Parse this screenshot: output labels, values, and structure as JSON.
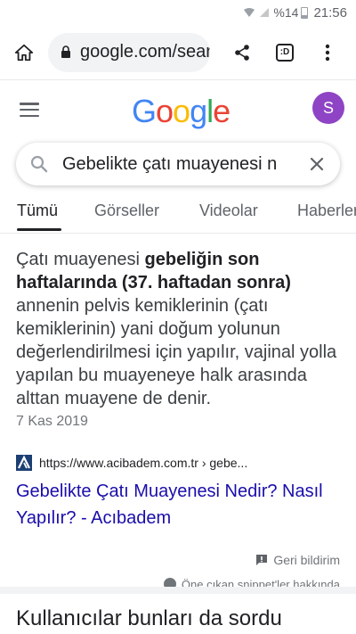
{
  "status_bar": {
    "battery_percent": "%14",
    "time": "21:56"
  },
  "chrome": {
    "url": "google.com/search"
  },
  "header": {
    "logo_letters": [
      "G",
      "o",
      "o",
      "g",
      "l",
      "e"
    ],
    "logo_colors": [
      "#4285F4",
      "#EA4335",
      "#FBBC05",
      "#4285F4",
      "#34A853",
      "#EA4335"
    ],
    "avatar_letter": "S",
    "avatar_color": "#8e44c4"
  },
  "search": {
    "query": "Gebelikte çatı muayenesi n"
  },
  "tabs": [
    {
      "label": "Tümü",
      "active": true
    },
    {
      "label": "Görseller"
    },
    {
      "label": "Videolar"
    },
    {
      "label": "Haberler"
    }
  ],
  "snippet": {
    "text_pre": "Çatı muayenesi ",
    "text_bold": "gebeliğin son haftalarında (37. haftadan sonra)",
    "text_post": " annenin pelvis kemiklerinin (çatı kemiklerinin) yani doğum yolunun değerlendirilmesi için yapılır, vajinal yolla yapılan bu muayeneye halk arasında alttan muayene de denir.",
    "date": "7 Kas 2019"
  },
  "result": {
    "url": "https://www.acibadem.com.tr › gebe...",
    "title": "Gebelikte Çatı Muayenesi Nedir? Nasıl Yapılır? - Acıbadem"
  },
  "feedback_label": "Geri bildirim",
  "about_label": "Öne çıkan snippet'ler hakkında",
  "people_also_ask": "Kullanıcılar bunları da sordu"
}
